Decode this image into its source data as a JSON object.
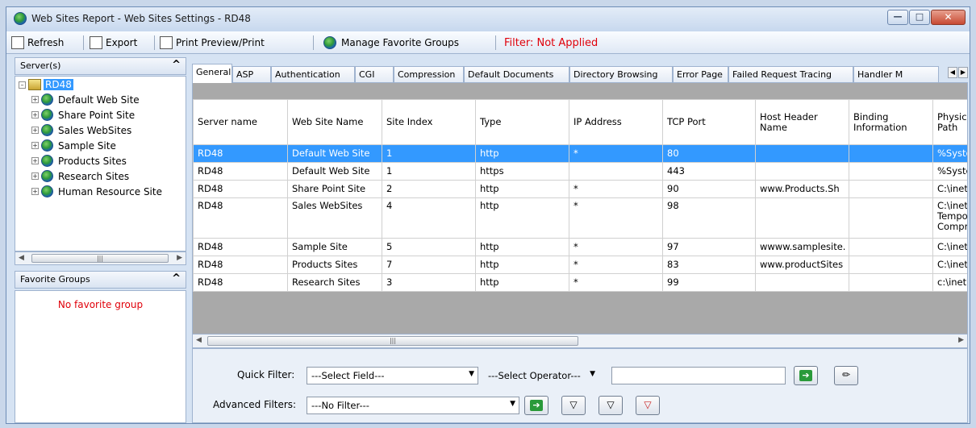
{
  "window": {
    "title": "Web Sites Report - Web Sites Settings - RD48"
  },
  "toolbar": {
    "refresh": "Refresh",
    "export": "Export",
    "print": "Print Preview/Print",
    "manage": "Manage Favorite Groups",
    "filter_status": "Filter: Not Applied"
  },
  "servers_panel": {
    "title": "Server(s)",
    "root": "RD48",
    "sites": [
      "Default Web Site",
      "Share Point Site",
      "Sales WebSites",
      "Sample Site",
      "Products Sites",
      "Research Sites",
      "Human Resource Site"
    ]
  },
  "favorites_panel": {
    "title": "Favorite Groups",
    "empty": "No favorite group"
  },
  "tabs": [
    "General",
    "ASP",
    "Authentication",
    "CGI",
    "Compression",
    "Default Documents",
    "Directory Browsing",
    "Error Page",
    "Failed Request Tracing",
    "Handler M"
  ],
  "grid": {
    "columns": [
      "Server name",
      "Web Site Name",
      "Site Index",
      "Type",
      "IP Address",
      "TCP Port",
      "Host Header Name",
      "Binding Information",
      "Physic Path"
    ],
    "rows": [
      [
        "RD48",
        "Default Web Site",
        "1",
        "http",
        "*",
        "80",
        "",
        "",
        "%Syste"
      ],
      [
        "RD48",
        "Default Web Site",
        "1",
        "https",
        "",
        "443",
        "",
        "",
        "%Syste"
      ],
      [
        "RD48",
        "Share Point Site",
        "2",
        "http",
        "*",
        "90",
        "www.Products.Sh",
        "",
        "C:\\inetp"
      ],
      [
        "RD48",
        "Sales WebSites",
        "4",
        "http",
        "*",
        "98",
        "",
        "",
        "C:\\inetp Tempo Compre"
      ],
      [
        "RD48",
        "Sample Site",
        "5",
        "http",
        "*",
        "97",
        "wwww.samplesite.",
        "",
        "C:\\inetp"
      ],
      [
        "RD48",
        "Products Sites",
        "7",
        "http",
        "*",
        "83",
        "www.productSites",
        "",
        "C:\\inetp"
      ],
      [
        "RD48",
        "Research Sites",
        "3",
        "http",
        "*",
        "99",
        "",
        "",
        "c:\\inetp"
      ]
    ],
    "selected_row": 0
  },
  "filters": {
    "quick_label": "Quick Filter:",
    "field_placeholder": "---Select Field---",
    "operator_placeholder": "---Select Operator---",
    "advanced_label": "Advanced Filters:",
    "advanced_value": "---No Filter---"
  }
}
